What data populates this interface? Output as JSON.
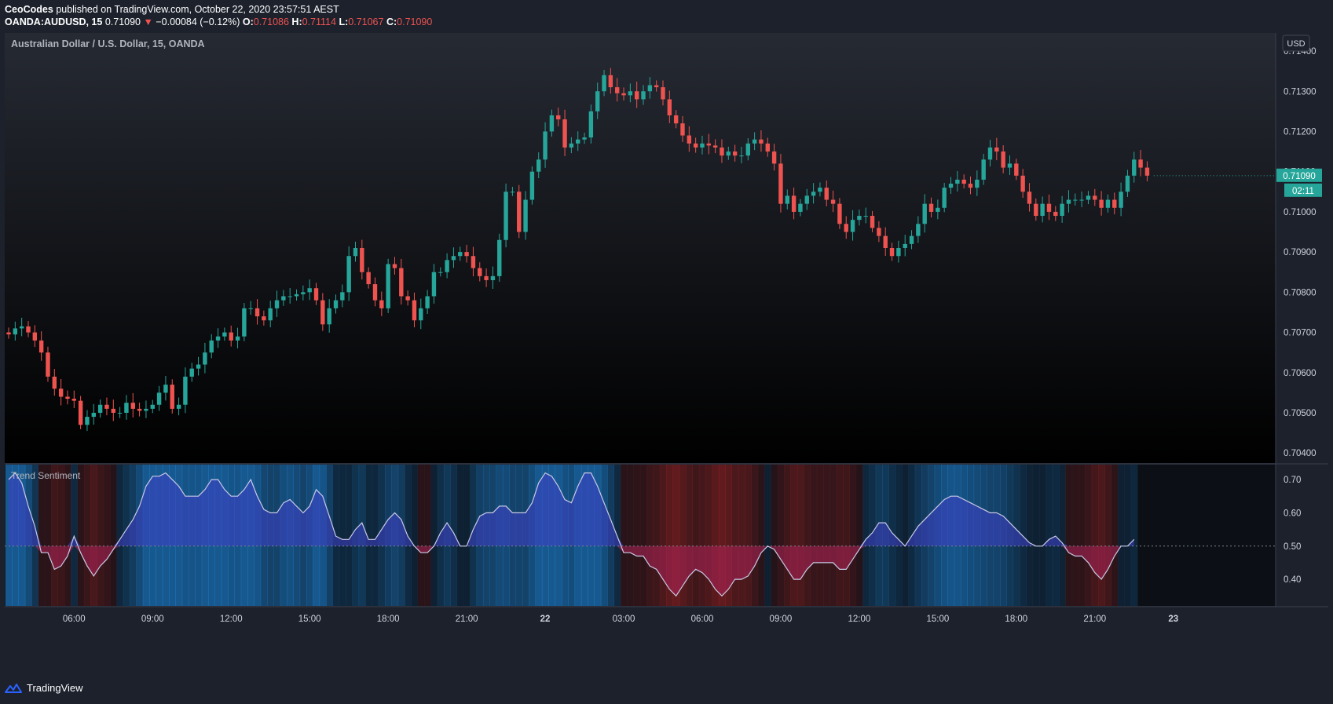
{
  "header": {
    "author": "CeoCodes",
    "published_text": "published on TradingView.com, October 22, 2020 23:57:51 AEST",
    "symbol": "OANDA:AUDUSD, 15",
    "last": "0.71090",
    "change": "−0.00084 (−0.12%)",
    "o_label": "O:",
    "o_value": "0.71086",
    "h_label": "H:",
    "h_value": "0.71114",
    "l_label": "L:",
    "l_value": "0.71067",
    "c_label": "C:",
    "c_value": "0.71090"
  },
  "main": {
    "pair_title": "Australian Dollar / U.S. Dollar, 15, OANDA",
    "currency_button": "USD",
    "price_badge": "0.71090",
    "countdown_badge": "02:11"
  },
  "indicator": {
    "title": "Trend Sentiment"
  },
  "footer": {
    "brand": "TradingView"
  },
  "colors": {
    "up": "#26a69a",
    "down": "#ef5350",
    "sentiment_line": "#c9c9e6",
    "bull_fill": "#3f3fc8",
    "bear_fill": "#b0245a"
  },
  "chart_data": [
    {
      "type": "candlestick",
      "title": "Australian Dollar / U.S. Dollar, 15, OANDA",
      "y_ticks": [
        "0.71400",
        "0.71300",
        "0.71200",
        "0.71100",
        "0.71000",
        "0.70900",
        "0.70800",
        "0.70700",
        "0.70600",
        "0.70500",
        "0.70400"
      ],
      "ylim": [
        0.70375,
        0.71445
      ],
      "x_ticks": [
        "06:00",
        "09:00",
        "12:00",
        "15:00",
        "18:00",
        "21:00",
        "22",
        "03:00",
        "06:00",
        "09:00",
        "12:00",
        "15:00",
        "18:00",
        "21:00",
        "23"
      ],
      "close_series": [
        0.70695,
        0.7071,
        0.70715,
        0.707,
        0.7068,
        0.7065,
        0.7059,
        0.7056,
        0.7054,
        0.70535,
        0.7053,
        0.7047,
        0.7049,
        0.705,
        0.7052,
        0.7051,
        0.705,
        0.705,
        0.70525,
        0.7051,
        0.70505,
        0.7051,
        0.7052,
        0.7055,
        0.7057,
        0.7051,
        0.7052,
        0.7059,
        0.7061,
        0.7062,
        0.7065,
        0.7068,
        0.7069,
        0.707,
        0.7068,
        0.7069,
        0.7076,
        0.7076,
        0.7074,
        0.7073,
        0.7076,
        0.7078,
        0.7079,
        0.7079,
        0.70795,
        0.708,
        0.7081,
        0.7078,
        0.7072,
        0.7076,
        0.7078,
        0.708,
        0.7089,
        0.7091,
        0.7085,
        0.7082,
        0.7078,
        0.7076,
        0.7087,
        0.7086,
        0.7079,
        0.7078,
        0.7073,
        0.7076,
        0.7079,
        0.7085,
        0.7085,
        0.7088,
        0.7089,
        0.709,
        0.7089,
        0.7086,
        0.7084,
        0.7083,
        0.7084,
        0.7093,
        0.7105,
        0.7105,
        0.7095,
        0.7103,
        0.711,
        0.7113,
        0.712,
        0.7124,
        0.7123,
        0.7116,
        0.7117,
        0.7118,
        0.71185,
        0.7125,
        0.713,
        0.7134,
        0.7131,
        0.71295,
        0.7129,
        0.713,
        0.7128,
        0.713,
        0.71315,
        0.7131,
        0.7128,
        0.7124,
        0.7122,
        0.7119,
        0.7117,
        0.7116,
        0.7117,
        0.71165,
        0.7116,
        0.7114,
        0.7115,
        0.7114,
        0.7114,
        0.7117,
        0.7118,
        0.7117,
        0.7115,
        0.7112,
        0.7102,
        0.7104,
        0.71,
        0.7102,
        0.7104,
        0.7105,
        0.7106,
        0.7103,
        0.7102,
        0.7097,
        0.7095,
        0.7098,
        0.7099,
        0.7099,
        0.7096,
        0.7094,
        0.7091,
        0.7089,
        0.7091,
        0.7092,
        0.7094,
        0.7097,
        0.7102,
        0.71,
        0.7101,
        0.7106,
        0.7107,
        0.7108,
        0.7107,
        0.7106,
        0.7108,
        0.7113,
        0.7116,
        0.7115,
        0.7111,
        0.7112,
        0.7109,
        0.7105,
        0.7102,
        0.7099,
        0.7102,
        0.71,
        0.7099,
        0.7102,
        0.7103,
        0.7103,
        0.7103,
        0.7104,
        0.7103,
        0.7101,
        0.7103,
        0.7101,
        0.7105,
        0.7109,
        0.7113,
        0.7111,
        0.7109
      ]
    },
    {
      "type": "area",
      "title": "Trend Sentiment",
      "y_ticks": [
        "0.70",
        "0.60",
        "0.50",
        "0.40"
      ],
      "ylim": [
        0.32,
        0.745
      ],
      "baseline": 0.5,
      "values": [
        0.7,
        0.72,
        0.69,
        0.62,
        0.56,
        0.48,
        0.48,
        0.43,
        0.44,
        0.47,
        0.53,
        0.48,
        0.44,
        0.41,
        0.44,
        0.46,
        0.49,
        0.52,
        0.55,
        0.58,
        0.62,
        0.68,
        0.71,
        0.71,
        0.72,
        0.7,
        0.68,
        0.65,
        0.65,
        0.65,
        0.67,
        0.7,
        0.7,
        0.67,
        0.65,
        0.65,
        0.67,
        0.7,
        0.65,
        0.61,
        0.6,
        0.6,
        0.63,
        0.64,
        0.62,
        0.6,
        0.62,
        0.67,
        0.65,
        0.59,
        0.53,
        0.52,
        0.52,
        0.55,
        0.57,
        0.52,
        0.52,
        0.55,
        0.58,
        0.6,
        0.58,
        0.53,
        0.5,
        0.48,
        0.48,
        0.5,
        0.54,
        0.57,
        0.54,
        0.5,
        0.5,
        0.55,
        0.59,
        0.6,
        0.6,
        0.62,
        0.62,
        0.6,
        0.6,
        0.6,
        0.63,
        0.69,
        0.72,
        0.71,
        0.68,
        0.64,
        0.63,
        0.68,
        0.72,
        0.72,
        0.68,
        0.63,
        0.58,
        0.53,
        0.48,
        0.48,
        0.47,
        0.47,
        0.44,
        0.43,
        0.4,
        0.37,
        0.35,
        0.38,
        0.41,
        0.43,
        0.42,
        0.4,
        0.37,
        0.35,
        0.37,
        0.4,
        0.4,
        0.41,
        0.44,
        0.48,
        0.5,
        0.49,
        0.46,
        0.43,
        0.4,
        0.4,
        0.43,
        0.45,
        0.45,
        0.45,
        0.45,
        0.43,
        0.43,
        0.46,
        0.49,
        0.52,
        0.54,
        0.57,
        0.57,
        0.54,
        0.52,
        0.5,
        0.53,
        0.56,
        0.58,
        0.6,
        0.62,
        0.64,
        0.65,
        0.65,
        0.64,
        0.63,
        0.62,
        0.61,
        0.6,
        0.6,
        0.59,
        0.57,
        0.55,
        0.53,
        0.51,
        0.5,
        0.5,
        0.52,
        0.53,
        0.51,
        0.48,
        0.47,
        0.47,
        0.45,
        0.42,
        0.4,
        0.43,
        0.47,
        0.5,
        0.5,
        0.52
      ]
    }
  ]
}
